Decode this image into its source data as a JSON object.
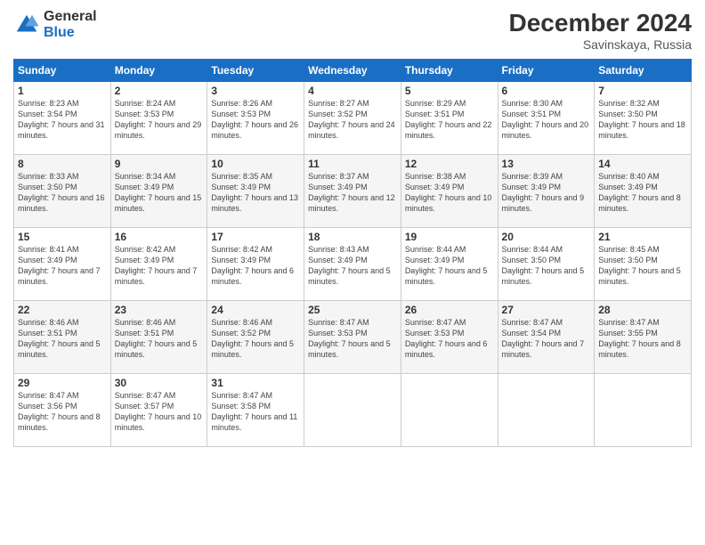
{
  "header": {
    "logo_general": "General",
    "logo_blue": "Blue",
    "month_title": "December 2024",
    "location": "Savinskaya, Russia"
  },
  "days_of_week": [
    "Sunday",
    "Monday",
    "Tuesday",
    "Wednesday",
    "Thursday",
    "Friday",
    "Saturday"
  ],
  "weeks": [
    [
      {
        "day": "1",
        "sunrise": "8:23 AM",
        "sunset": "3:54 PM",
        "daylight": "7 hours and 31 minutes."
      },
      {
        "day": "2",
        "sunrise": "8:24 AM",
        "sunset": "3:53 PM",
        "daylight": "7 hours and 29 minutes."
      },
      {
        "day": "3",
        "sunrise": "8:26 AM",
        "sunset": "3:53 PM",
        "daylight": "7 hours and 26 minutes."
      },
      {
        "day": "4",
        "sunrise": "8:27 AM",
        "sunset": "3:52 PM",
        "daylight": "7 hours and 24 minutes."
      },
      {
        "day": "5",
        "sunrise": "8:29 AM",
        "sunset": "3:51 PM",
        "daylight": "7 hours and 22 minutes."
      },
      {
        "day": "6",
        "sunrise": "8:30 AM",
        "sunset": "3:51 PM",
        "daylight": "7 hours and 20 minutes."
      },
      {
        "day": "7",
        "sunrise": "8:32 AM",
        "sunset": "3:50 PM",
        "daylight": "7 hours and 18 minutes."
      }
    ],
    [
      {
        "day": "8",
        "sunrise": "8:33 AM",
        "sunset": "3:50 PM",
        "daylight": "7 hours and 16 minutes."
      },
      {
        "day": "9",
        "sunrise": "8:34 AM",
        "sunset": "3:49 PM",
        "daylight": "7 hours and 15 minutes."
      },
      {
        "day": "10",
        "sunrise": "8:35 AM",
        "sunset": "3:49 PM",
        "daylight": "7 hours and 13 minutes."
      },
      {
        "day": "11",
        "sunrise": "8:37 AM",
        "sunset": "3:49 PM",
        "daylight": "7 hours and 12 minutes."
      },
      {
        "day": "12",
        "sunrise": "8:38 AM",
        "sunset": "3:49 PM",
        "daylight": "7 hours and 10 minutes."
      },
      {
        "day": "13",
        "sunrise": "8:39 AM",
        "sunset": "3:49 PM",
        "daylight": "7 hours and 9 minutes."
      },
      {
        "day": "14",
        "sunrise": "8:40 AM",
        "sunset": "3:49 PM",
        "daylight": "7 hours and 8 minutes."
      }
    ],
    [
      {
        "day": "15",
        "sunrise": "8:41 AM",
        "sunset": "3:49 PM",
        "daylight": "7 hours and 7 minutes."
      },
      {
        "day": "16",
        "sunrise": "8:42 AM",
        "sunset": "3:49 PM",
        "daylight": "7 hours and 7 minutes."
      },
      {
        "day": "17",
        "sunrise": "8:42 AM",
        "sunset": "3:49 PM",
        "daylight": "7 hours and 6 minutes."
      },
      {
        "day": "18",
        "sunrise": "8:43 AM",
        "sunset": "3:49 PM",
        "daylight": "7 hours and 5 minutes."
      },
      {
        "day": "19",
        "sunrise": "8:44 AM",
        "sunset": "3:49 PM",
        "daylight": "7 hours and 5 minutes."
      },
      {
        "day": "20",
        "sunrise": "8:44 AM",
        "sunset": "3:50 PM",
        "daylight": "7 hours and 5 minutes."
      },
      {
        "day": "21",
        "sunrise": "8:45 AM",
        "sunset": "3:50 PM",
        "daylight": "7 hours and 5 minutes."
      }
    ],
    [
      {
        "day": "22",
        "sunrise": "8:46 AM",
        "sunset": "3:51 PM",
        "daylight": "7 hours and 5 minutes."
      },
      {
        "day": "23",
        "sunrise": "8:46 AM",
        "sunset": "3:51 PM",
        "daylight": "7 hours and 5 minutes."
      },
      {
        "day": "24",
        "sunrise": "8:46 AM",
        "sunset": "3:52 PM",
        "daylight": "7 hours and 5 minutes."
      },
      {
        "day": "25",
        "sunrise": "8:47 AM",
        "sunset": "3:53 PM",
        "daylight": "7 hours and 5 minutes."
      },
      {
        "day": "26",
        "sunrise": "8:47 AM",
        "sunset": "3:53 PM",
        "daylight": "7 hours and 6 minutes."
      },
      {
        "day": "27",
        "sunrise": "8:47 AM",
        "sunset": "3:54 PM",
        "daylight": "7 hours and 7 minutes."
      },
      {
        "day": "28",
        "sunrise": "8:47 AM",
        "sunset": "3:55 PM",
        "daylight": "7 hours and 8 minutes."
      }
    ],
    [
      {
        "day": "29",
        "sunrise": "8:47 AM",
        "sunset": "3:56 PM",
        "daylight": "7 hours and 8 minutes."
      },
      {
        "day": "30",
        "sunrise": "8:47 AM",
        "sunset": "3:57 PM",
        "daylight": "7 hours and 10 minutes."
      },
      {
        "day": "31",
        "sunrise": "8:47 AM",
        "sunset": "3:58 PM",
        "daylight": "7 hours and 11 minutes."
      },
      null,
      null,
      null,
      null
    ]
  ]
}
